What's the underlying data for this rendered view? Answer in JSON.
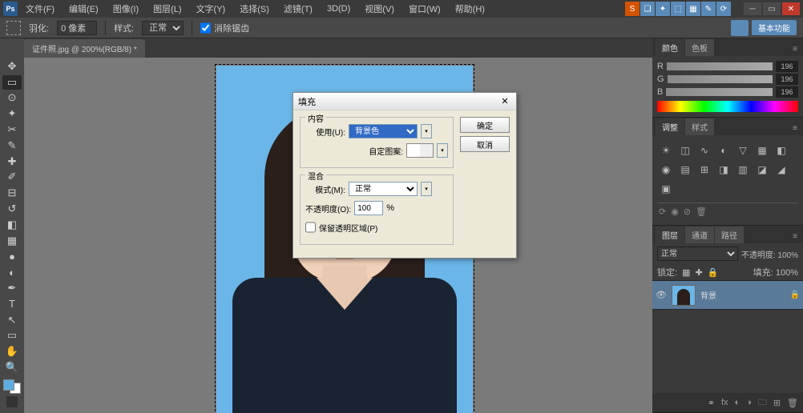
{
  "menu": {
    "items": [
      "文件(F)",
      "编辑(E)",
      "图像(I)",
      "图层(L)",
      "文字(Y)",
      "选择(S)",
      "滤镜(T)",
      "3D(D)",
      "视图(V)",
      "窗口(W)",
      "帮助(H)"
    ]
  },
  "optbar": {
    "label1": "羽化:",
    "val1": "0 像素",
    "label2": "样式:",
    "val2": "正常",
    "chk1": "消除锯齿",
    "cloud": "基本功能"
  },
  "tab": {
    "title": "证件照.jpg @ 200%(RGB/8) *"
  },
  "dialog": {
    "title": "填充",
    "section1": "内容",
    "use_label": "使用(U):",
    "use_value": "背景色",
    "pattern_label": "自定图案:",
    "section2": "混合",
    "mode_label": "模式(M):",
    "mode_value": "正常",
    "opacity_label": "不透明度(O):",
    "opacity_value": "100",
    "opacity_unit": "%",
    "preserve": "保留透明区域(P)",
    "ok": "确定",
    "cancel": "取消"
  },
  "panels": {
    "color": {
      "tab1": "颜色",
      "tab2": "色板",
      "vals": [
        "196",
        "196",
        "196"
      ]
    },
    "adjust": {
      "tab1": "调整",
      "tab2": "样式"
    },
    "layers": {
      "tab1": "图层",
      "tab2": "通道",
      "tab3": "路径",
      "blend": "正常",
      "opacity": "不透明度: 100%",
      "lock": "锁定:",
      "fill": "填充: 100%",
      "layer1": "背景"
    }
  }
}
